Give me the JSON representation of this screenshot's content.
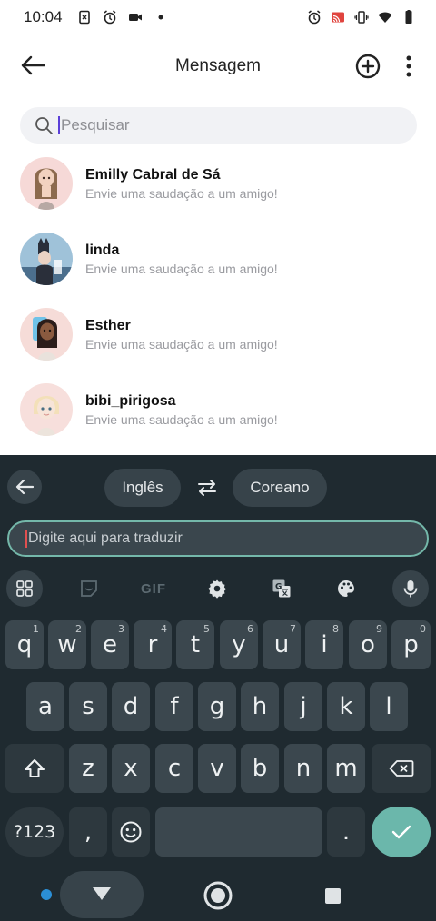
{
  "status": {
    "time": "10:04"
  },
  "header": {
    "title": "Mensagem"
  },
  "search": {
    "placeholder": "Pesquisar"
  },
  "contacts": [
    {
      "name": "Emilly Cabral de Sá",
      "subtitle": "Envie uma saudação a um amigo!"
    },
    {
      "name": "linda",
      "subtitle": "Envie uma saudação a um amigo!"
    },
    {
      "name": "Esther",
      "subtitle": "Envie uma saudação a um amigo!"
    },
    {
      "name": "bibi_pirigosa",
      "subtitle": "Envie uma saudação a um amigo!"
    }
  ],
  "keyboard": {
    "source_lang": "Inglês",
    "target_lang": "Coreano",
    "translate_placeholder": "Digite aqui para traduzir",
    "gif_label": "GIF",
    "row1": [
      {
        "k": "q",
        "h": "1"
      },
      {
        "k": "w",
        "h": "2"
      },
      {
        "k": "e",
        "h": "3"
      },
      {
        "k": "r",
        "h": "4"
      },
      {
        "k": "t",
        "h": "5"
      },
      {
        "k": "y",
        "h": "6"
      },
      {
        "k": "u",
        "h": "7"
      },
      {
        "k": "i",
        "h": "8"
      },
      {
        "k": "o",
        "h": "9"
      },
      {
        "k": "p",
        "h": "0"
      }
    ],
    "row2": [
      "a",
      "s",
      "d",
      "f",
      "g",
      "h",
      "j",
      "k",
      "l"
    ],
    "row3": [
      "z",
      "x",
      "c",
      "v",
      "b",
      "n",
      "m"
    ],
    "symbols_label": "?123",
    "comma": ",",
    "period": "."
  },
  "colors": {
    "keyboard_bg": "#1f2a30",
    "key_bg": "#3b474e",
    "accent": "#6bb7ab",
    "search_bg": "#f1f2f5"
  }
}
